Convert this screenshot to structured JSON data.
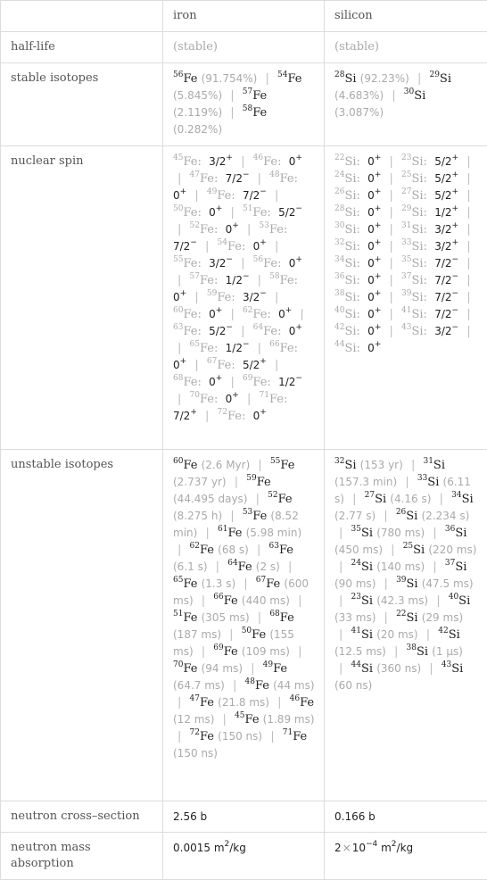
{
  "header": {
    "col1": "iron",
    "col2": "silicon"
  },
  "rows": {
    "half_life": {
      "label": "half-life",
      "iron": "(stable)",
      "silicon": "(stable)"
    },
    "stable_isotopes": {
      "label": "stable isotopes",
      "iron": [
        {
          "mass": "56",
          "symbol": "Fe",
          "value": "(91.754%)"
        },
        {
          "mass": "54",
          "symbol": "Fe",
          "value": "(5.845%)"
        },
        {
          "mass": "57",
          "symbol": "Fe",
          "value": "(2.119%)"
        },
        {
          "mass": "58",
          "symbol": "Fe",
          "value": "(0.282%)"
        }
      ],
      "silicon": [
        {
          "mass": "28",
          "symbol": "Si",
          "value": "(92.23%)"
        },
        {
          "mass": "29",
          "symbol": "Si",
          "value": "(4.683%)"
        },
        {
          "mass": "30",
          "symbol": "Si",
          "value": "(3.087%)"
        }
      ]
    },
    "nuclear_spin": {
      "label": "nuclear spin",
      "iron": [
        {
          "mass": "45",
          "symbol": "Fe",
          "spin": "3/2",
          "parity": "+"
        },
        {
          "mass": "46",
          "symbol": "Fe",
          "spin": "0",
          "parity": "+"
        },
        {
          "mass": "47",
          "symbol": "Fe",
          "spin": "7/2",
          "parity": "−"
        },
        {
          "mass": "48",
          "symbol": "Fe",
          "spin": "0",
          "parity": "+"
        },
        {
          "mass": "49",
          "symbol": "Fe",
          "spin": "7/2",
          "parity": "−"
        },
        {
          "mass": "50",
          "symbol": "Fe",
          "spin": "0",
          "parity": "+"
        },
        {
          "mass": "51",
          "symbol": "Fe",
          "spin": "5/2",
          "parity": "−"
        },
        {
          "mass": "52",
          "symbol": "Fe",
          "spin": "0",
          "parity": "+"
        },
        {
          "mass": "53",
          "symbol": "Fe",
          "spin": "7/2",
          "parity": "−"
        },
        {
          "mass": "54",
          "symbol": "Fe",
          "spin": "0",
          "parity": "+"
        },
        {
          "mass": "55",
          "symbol": "Fe",
          "spin": "3/2",
          "parity": "−"
        },
        {
          "mass": "56",
          "symbol": "Fe",
          "spin": "0",
          "parity": "+"
        },
        {
          "mass": "57",
          "symbol": "Fe",
          "spin": "1/2",
          "parity": "−"
        },
        {
          "mass": "58",
          "symbol": "Fe",
          "spin": "0",
          "parity": "+"
        },
        {
          "mass": "59",
          "symbol": "Fe",
          "spin": "3/2",
          "parity": "−"
        },
        {
          "mass": "60",
          "symbol": "Fe",
          "spin": "0",
          "parity": "+"
        },
        {
          "mass": "62",
          "symbol": "Fe",
          "spin": "0",
          "parity": "+"
        },
        {
          "mass": "63",
          "symbol": "Fe",
          "spin": "5/2",
          "parity": "−"
        },
        {
          "mass": "64",
          "symbol": "Fe",
          "spin": "0",
          "parity": "+"
        },
        {
          "mass": "65",
          "symbol": "Fe",
          "spin": "1/2",
          "parity": "−"
        },
        {
          "mass": "66",
          "symbol": "Fe",
          "spin": "0",
          "parity": "+"
        },
        {
          "mass": "67",
          "symbol": "Fe",
          "spin": "5/2",
          "parity": "+"
        },
        {
          "mass": "68",
          "symbol": "Fe",
          "spin": "0",
          "parity": "+"
        },
        {
          "mass": "69",
          "symbol": "Fe",
          "spin": "1/2",
          "parity": "−"
        },
        {
          "mass": "70",
          "symbol": "Fe",
          "spin": "0",
          "parity": "+"
        },
        {
          "mass": "71",
          "symbol": "Fe",
          "spin": "7/2",
          "parity": "+"
        },
        {
          "mass": "72",
          "symbol": "Fe",
          "spin": "0",
          "parity": "+"
        }
      ],
      "silicon": [
        {
          "mass": "22",
          "symbol": "Si",
          "spin": "0",
          "parity": "+"
        },
        {
          "mass": "23",
          "symbol": "Si",
          "spin": "5/2",
          "parity": "+"
        },
        {
          "mass": "24",
          "symbol": "Si",
          "spin": "0",
          "parity": "+"
        },
        {
          "mass": "25",
          "symbol": "Si",
          "spin": "5/2",
          "parity": "+"
        },
        {
          "mass": "26",
          "symbol": "Si",
          "spin": "0",
          "parity": "+"
        },
        {
          "mass": "27",
          "symbol": "Si",
          "spin": "5/2",
          "parity": "+"
        },
        {
          "mass": "28",
          "symbol": "Si",
          "spin": "0",
          "parity": "+"
        },
        {
          "mass": "29",
          "symbol": "Si",
          "spin": "1/2",
          "parity": "+"
        },
        {
          "mass": "30",
          "symbol": "Si",
          "spin": "0",
          "parity": "+"
        },
        {
          "mass": "31",
          "symbol": "Si",
          "spin": "3/2",
          "parity": "+"
        },
        {
          "mass": "32",
          "symbol": "Si",
          "spin": "0",
          "parity": "+"
        },
        {
          "mass": "33",
          "symbol": "Si",
          "spin": "3/2",
          "parity": "+"
        },
        {
          "mass": "34",
          "symbol": "Si",
          "spin": "0",
          "parity": "+"
        },
        {
          "mass": "35",
          "symbol": "Si",
          "spin": "7/2",
          "parity": "−"
        },
        {
          "mass": "36",
          "symbol": "Si",
          "spin": "0",
          "parity": "+"
        },
        {
          "mass": "37",
          "symbol": "Si",
          "spin": "7/2",
          "parity": "−"
        },
        {
          "mass": "38",
          "symbol": "Si",
          "spin": "0",
          "parity": "+"
        },
        {
          "mass": "39",
          "symbol": "Si",
          "spin": "7/2",
          "parity": "−"
        },
        {
          "mass": "40",
          "symbol": "Si",
          "spin": "0",
          "parity": "+"
        },
        {
          "mass": "41",
          "symbol": "Si",
          "spin": "7/2",
          "parity": "−"
        },
        {
          "mass": "42",
          "symbol": "Si",
          "spin": "0",
          "parity": "+"
        },
        {
          "mass": "43",
          "symbol": "Si",
          "spin": "3/2",
          "parity": "−"
        },
        {
          "mass": "44",
          "symbol": "Si",
          "spin": "0",
          "parity": "+"
        }
      ]
    },
    "unstable_isotopes": {
      "label": "unstable isotopes",
      "iron": [
        {
          "mass": "60",
          "symbol": "Fe",
          "value": "(2.6 Myr)"
        },
        {
          "mass": "55",
          "symbol": "Fe",
          "value": "(2.737 yr)"
        },
        {
          "mass": "59",
          "symbol": "Fe",
          "value": "(44.495 days)"
        },
        {
          "mass": "52",
          "symbol": "Fe",
          "value": "(8.275 h)"
        },
        {
          "mass": "53",
          "symbol": "Fe",
          "value": "(8.52 min)"
        },
        {
          "mass": "61",
          "symbol": "Fe",
          "value": "(5.98 min)"
        },
        {
          "mass": "62",
          "symbol": "Fe",
          "value": "(68 s)"
        },
        {
          "mass": "63",
          "symbol": "Fe",
          "value": "(6.1 s)"
        },
        {
          "mass": "64",
          "symbol": "Fe",
          "value": "(2 s)"
        },
        {
          "mass": "65",
          "symbol": "Fe",
          "value": "(1.3 s)"
        },
        {
          "mass": "67",
          "symbol": "Fe",
          "value": "(600 ms)"
        },
        {
          "mass": "66",
          "symbol": "Fe",
          "value": "(440 ms)"
        },
        {
          "mass": "51",
          "symbol": "Fe",
          "value": "(305 ms)"
        },
        {
          "mass": "68",
          "symbol": "Fe",
          "value": "(187 ms)"
        },
        {
          "mass": "50",
          "symbol": "Fe",
          "value": "(155 ms)"
        },
        {
          "mass": "69",
          "symbol": "Fe",
          "value": "(109 ms)"
        },
        {
          "mass": "70",
          "symbol": "Fe",
          "value": "(94 ms)"
        },
        {
          "mass": "49",
          "symbol": "Fe",
          "value": "(64.7 ms)"
        },
        {
          "mass": "48",
          "symbol": "Fe",
          "value": "(44 ms)"
        },
        {
          "mass": "47",
          "symbol": "Fe",
          "value": "(21.8 ms)"
        },
        {
          "mass": "46",
          "symbol": "Fe",
          "value": "(12 ms)"
        },
        {
          "mass": "45",
          "symbol": "Fe",
          "value": "(1.89 ms)"
        },
        {
          "mass": "72",
          "symbol": "Fe",
          "value": "(150 ns)"
        },
        {
          "mass": "71",
          "symbol": "Fe",
          "value": "(150 ns)"
        }
      ],
      "silicon": [
        {
          "mass": "32",
          "symbol": "Si",
          "value": "(153 yr)"
        },
        {
          "mass": "31",
          "symbol": "Si",
          "value": "(157.3 min)"
        },
        {
          "mass": "33",
          "symbol": "Si",
          "value": "(6.11 s)"
        },
        {
          "mass": "27",
          "symbol": "Si",
          "value": "(4.16 s)"
        },
        {
          "mass": "34",
          "symbol": "Si",
          "value": "(2.77 s)"
        },
        {
          "mass": "26",
          "symbol": "Si",
          "value": "(2.234 s)"
        },
        {
          "mass": "35",
          "symbol": "Si",
          "value": "(780 ms)"
        },
        {
          "mass": "36",
          "symbol": "Si",
          "value": "(450 ms)"
        },
        {
          "mass": "25",
          "symbol": "Si",
          "value": "(220 ms)"
        },
        {
          "mass": "24",
          "symbol": "Si",
          "value": "(140 ms)"
        },
        {
          "mass": "37",
          "symbol": "Si",
          "value": "(90 ms)"
        },
        {
          "mass": "39",
          "symbol": "Si",
          "value": "(47.5 ms)"
        },
        {
          "mass": "23",
          "symbol": "Si",
          "value": "(42.3 ms)"
        },
        {
          "mass": "40",
          "symbol": "Si",
          "value": "(33 ms)"
        },
        {
          "mass": "22",
          "symbol": "Si",
          "value": "(29 ms)"
        },
        {
          "mass": "41",
          "symbol": "Si",
          "value": "(20 ms)"
        },
        {
          "mass": "42",
          "symbol": "Si",
          "value": "(12.5 ms)"
        },
        {
          "mass": "38",
          "symbol": "Si",
          "value": "(1 µs)"
        },
        {
          "mass": "44",
          "symbol": "Si",
          "value": "(360 ns)"
        },
        {
          "mass": "43",
          "symbol": "Si",
          "value": "(60 ns)"
        }
      ]
    },
    "neutron_cross_section": {
      "label": "neutron cross–section",
      "iron": "2.56 b",
      "silicon": "0.166 b"
    },
    "neutron_mass_absorption": {
      "label": "neutron mass absorption",
      "iron": {
        "mantissa": "0.0015",
        "exponent": "",
        "unit": "m",
        "unit_exp": "2",
        "unit_tail": "/kg"
      },
      "silicon": {
        "mantissa": "2",
        "times": "×",
        "base": "10",
        "exponent": "−4",
        "unit": "m",
        "unit_exp": "2",
        "unit_tail": "/kg"
      }
    }
  }
}
